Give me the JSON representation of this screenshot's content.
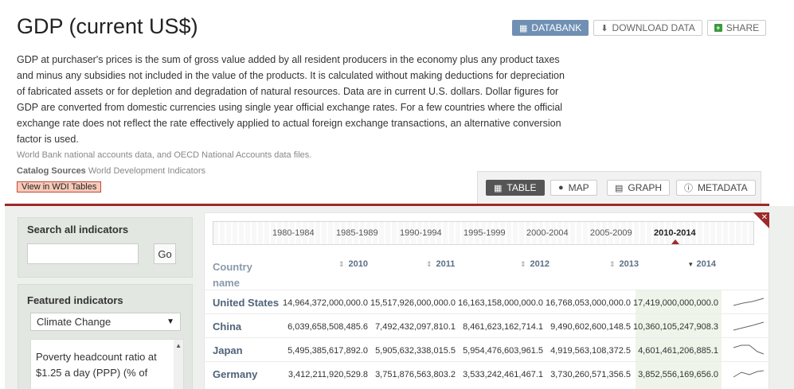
{
  "indicator": {
    "title": "GDP (current US$)",
    "description": "GDP at purchaser's prices is the sum of gross value added by all resident producers in the economy plus any product taxes and minus any subsidies not included in the value of the products. It is calculated without making deductions for depreciation of fabricated assets or for depletion and degradation of natural resources. Data are in current U.S. dollars. Dollar figures for GDP are converted from domestic currencies using single year official exchange rates. For a few countries where the official exchange rate does not reflect the rate effectively applied to actual foreign exchange transactions, an alternative conversion factor is used.",
    "source": "World Bank national accounts data, and OECD National Accounts data files.",
    "catalog_label": "Catalog Sources",
    "catalog_value": "World Development Indicators",
    "wdi_button": "View in WDI Tables"
  },
  "actions": {
    "databank": "DATABANK",
    "download": "DOWNLOAD DATA",
    "share": "SHARE"
  },
  "views": {
    "table": "TABLE",
    "map": "MAP",
    "graph": "GRAPH",
    "metadata": "METADATA"
  },
  "sidebar": {
    "search_heading": "Search all indicators",
    "search_value": "",
    "go_button": "Go",
    "featured_heading": "Featured indicators",
    "featured_selected": "Climate Change",
    "featured_item": "Poverty headcount ratio at $1.25 a day (PPP) (% of"
  },
  "periods": {
    "items": [
      "1980-1984",
      "1985-1989",
      "1990-1994",
      "1995-1999",
      "2000-2004",
      "2005-2009",
      "2010-2014"
    ],
    "active": "2010-2014"
  },
  "table": {
    "country_header": "Country name",
    "years": [
      "2010",
      "2011",
      "2012",
      "2013",
      "2014"
    ],
    "sorted_year": "2014",
    "rows": [
      {
        "country": "United States",
        "values": [
          "14,964,372,000,000.0",
          "15,517,926,000,000.0",
          "16,163,158,000,000.0",
          "16,768,053,000,000.0",
          "17,419,000,000,000.0"
        ]
      },
      {
        "country": "China",
        "values": [
          "6,039,658,508,485.6",
          "7,492,432,097,810.1",
          "8,461,623,162,714.1",
          "9,490,602,600,148.5",
          "10,360,105,247,908.3"
        ]
      },
      {
        "country": "Japan",
        "values": [
          "5,495,385,617,892.0",
          "5,905,632,338,015.5",
          "5,954,476,603,961.5",
          "4,919,563,108,372.5",
          "4,601,461,206,885.1"
        ]
      },
      {
        "country": "Germany",
        "values": [
          "3,412,211,920,529.8",
          "3,751,876,563,803.2",
          "3,533,242,461,467.1",
          "3,730,260,571,356.5",
          "3,852,556,169,656.0"
        ]
      }
    ]
  },
  "colors": {
    "accent_red": "#9e2a2a",
    "databank_blue": "#6f8fb3",
    "header_text": "#5a6f86"
  },
  "icons": {
    "databank": "database-icon",
    "download": "download-arrow-icon",
    "share": "plus-square-icon",
    "table": "table-grid-icon",
    "map": "globe-icon",
    "graph": "chart-icon",
    "metadata": "info-icon"
  }
}
